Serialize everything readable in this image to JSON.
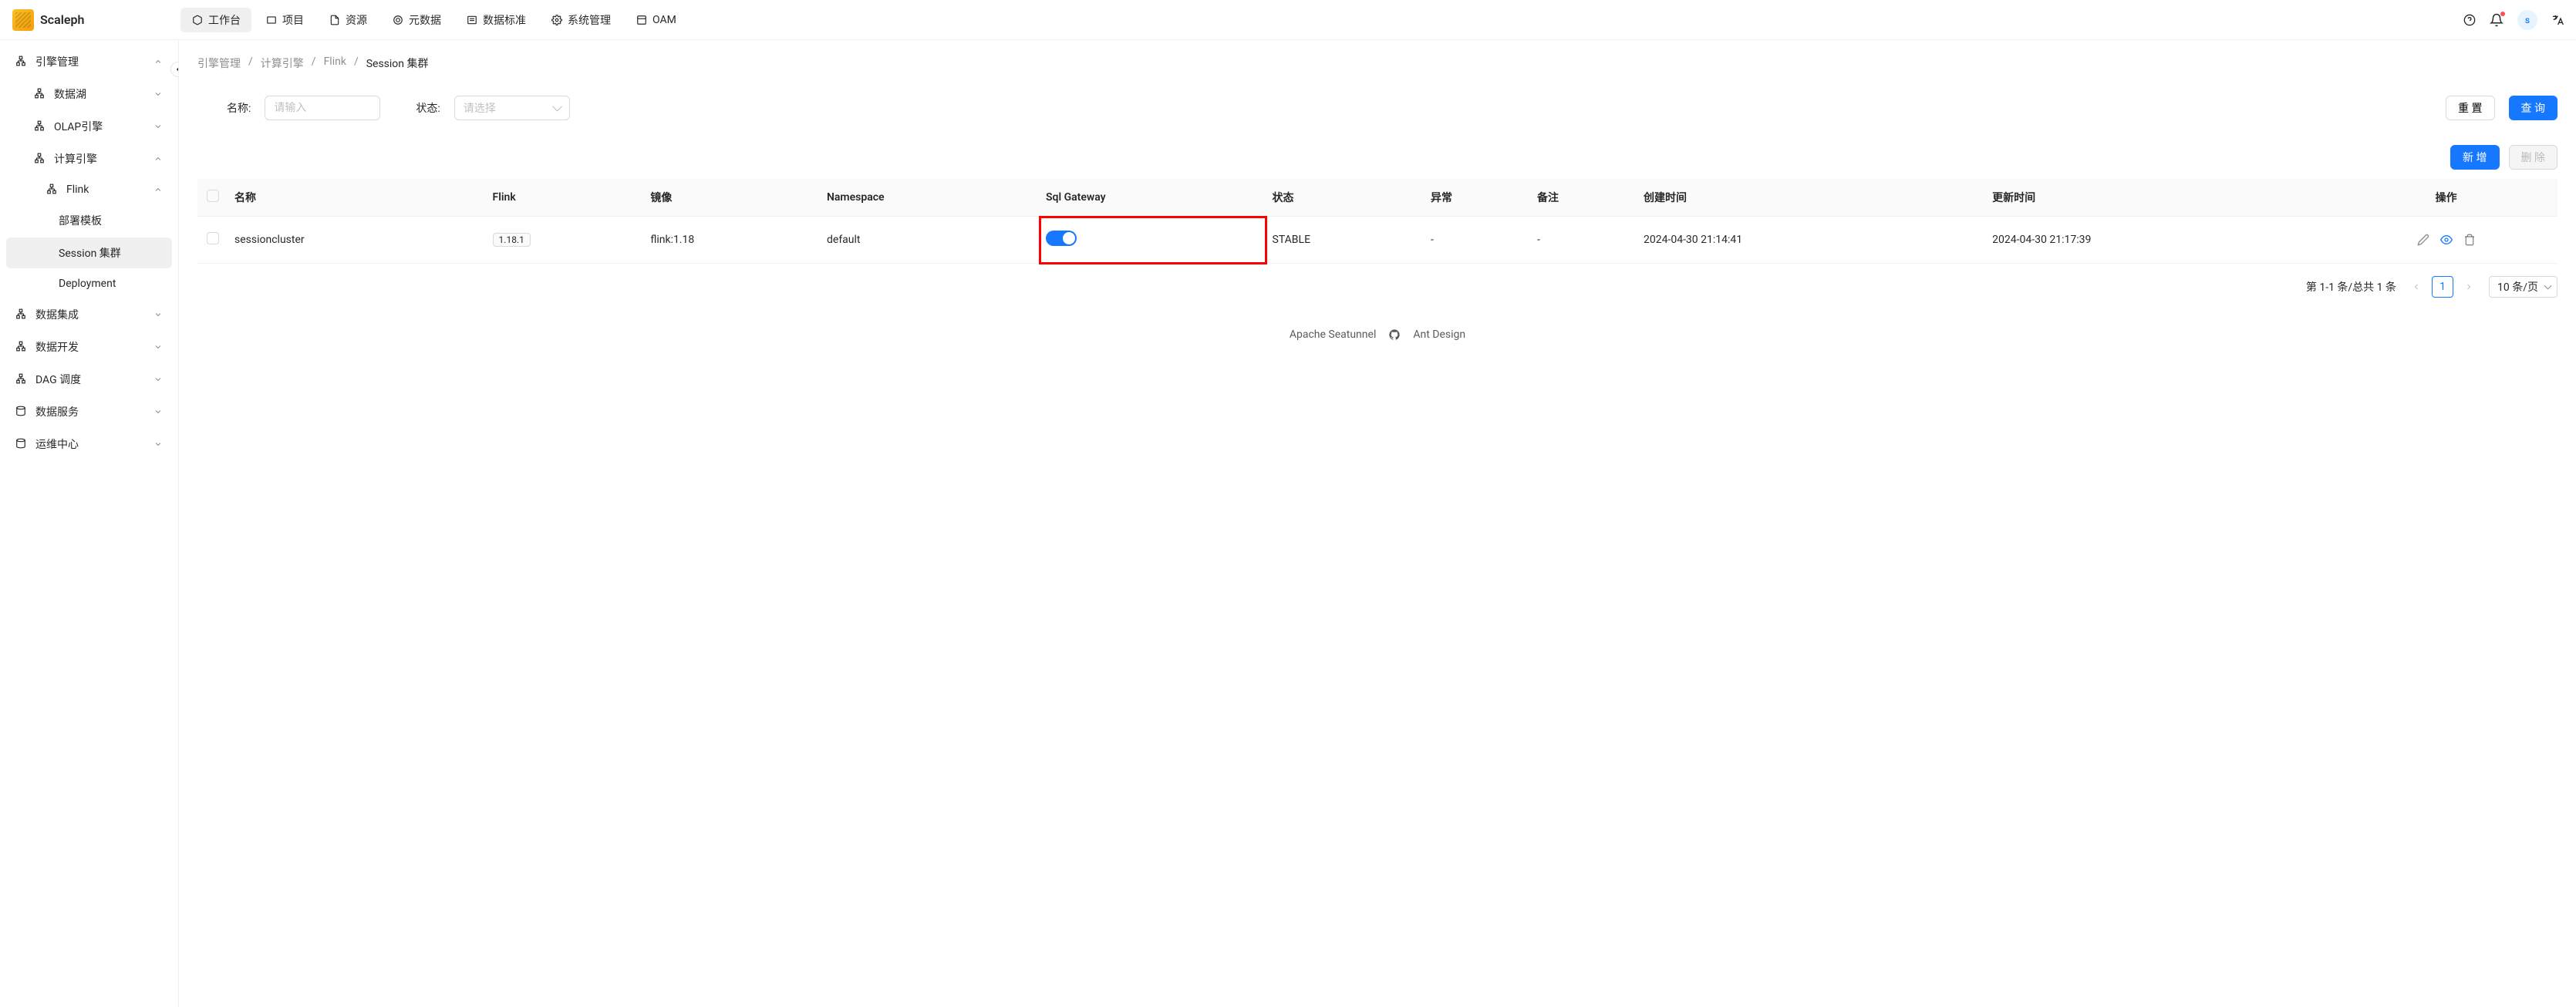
{
  "brand": "Scaleph",
  "topnav": [
    {
      "label": "工作台"
    },
    {
      "label": "项目"
    },
    {
      "label": "资源"
    },
    {
      "label": "元数据"
    },
    {
      "label": "数据标准"
    },
    {
      "label": "系统管理"
    },
    {
      "label": "OAM"
    }
  ],
  "avatar_letter": "s",
  "sidebar": {
    "engine_mgmt": "引擎管理",
    "datalake": "数据湖",
    "olap": "OLAP引擎",
    "compute": "计算引擎",
    "flink": "Flink",
    "deploy_tpl": "部署模板",
    "session_cluster": "Session 集群",
    "deployment": "Deployment",
    "data_integration": "数据集成",
    "data_dev": "数据开发",
    "dag": "DAG 调度",
    "data_service": "数据服务",
    "ops": "运维中心"
  },
  "breadcrumb": [
    "引擎管理",
    "计算引擎",
    "Flink",
    "Session 集群"
  ],
  "filters": {
    "name_label": "名称:",
    "name_placeholder": "请输入",
    "status_label": "状态:",
    "status_placeholder": "请选择",
    "reset": "重 置",
    "search": "查 询"
  },
  "actions": {
    "add": "新 增",
    "delete": "删 除"
  },
  "table": {
    "headers": [
      "名称",
      "Flink",
      "镜像",
      "Namespace",
      "Sql Gateway",
      "状态",
      "异常",
      "备注",
      "创建时间",
      "更新时间",
      "操作"
    ],
    "rows": [
      {
        "name": "sessioncluster",
        "flink": "1.18.1",
        "image": "flink:1.18",
        "namespace": "default",
        "gateway_on": true,
        "status": "STABLE",
        "exception": "-",
        "remark": "-",
        "created": "2024-04-30 21:14:41",
        "updated": "2024-04-30 21:17:39"
      }
    ]
  },
  "pagination": {
    "info": "第 1-1 条/总共 1 条",
    "current": "1",
    "page_size": "10 条/页"
  },
  "footer": {
    "seatunnel": "Apache Seatunnel",
    "antd": "Ant Design"
  }
}
